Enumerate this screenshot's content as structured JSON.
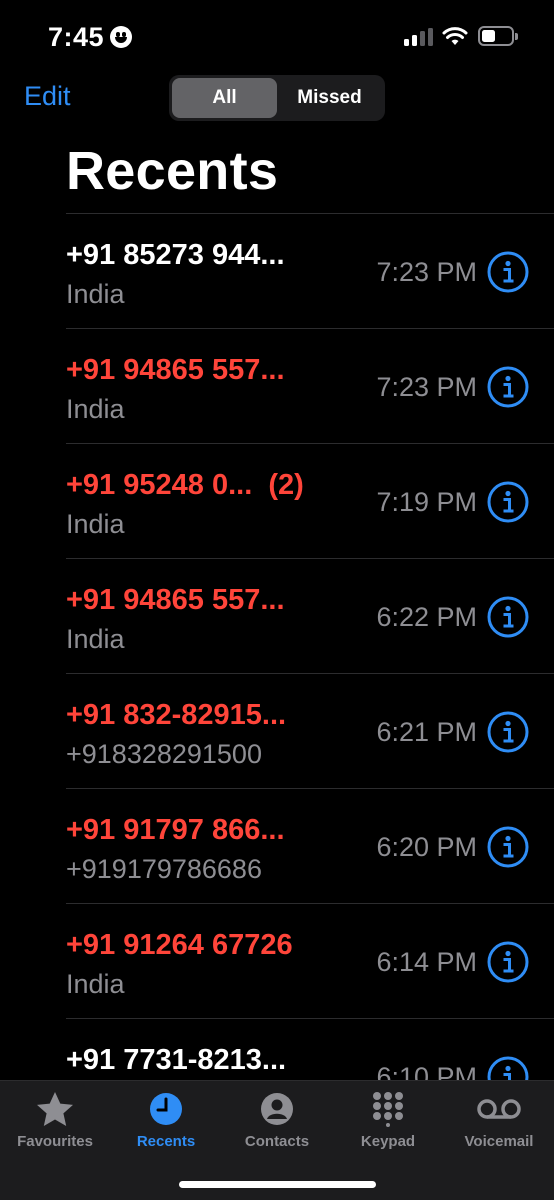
{
  "status_bar": {
    "time": "7:45",
    "emoji_icon": "smiley-face-icon",
    "signal_icon": "cellular-signal-icon",
    "wifi_icon": "wifi-icon",
    "battery_icon": "battery-icon",
    "battery_level": 0.45
  },
  "header": {
    "edit_label": "Edit",
    "segments": [
      {
        "label": "All",
        "selected": true
      },
      {
        "label": "Missed",
        "selected": false
      }
    ],
    "title": "Recents"
  },
  "calls": [
    {
      "name": "+91 85273 944...",
      "subtitle": "India",
      "time": "7:23 PM",
      "missed": false
    },
    {
      "name": "+91 94865 557...",
      "subtitle": "India",
      "time": "7:23 PM",
      "missed": true
    },
    {
      "name": "+91 95248 0...  (2)",
      "subtitle": "India",
      "time": "7:19 PM",
      "missed": true
    },
    {
      "name": "+91 94865 557...",
      "subtitle": "India",
      "time": "6:22 PM",
      "missed": true
    },
    {
      "name": "+91 832-82915...",
      "subtitle": "+918328291500",
      "time": "6:21 PM",
      "missed": true
    },
    {
      "name": "+91 91797 866...",
      "subtitle": "+919179786686",
      "time": "6:20 PM",
      "missed": true
    },
    {
      "name": "+91 91264 67726",
      "subtitle": "India",
      "time": "6:14 PM",
      "missed": true
    },
    {
      "name": "+91 7731-8213...",
      "subtitle": "",
      "time": "6:10 PM",
      "missed": false
    }
  ],
  "tab_bar": {
    "tabs": [
      {
        "label": "Favourites",
        "icon": "star-icon",
        "active": false
      },
      {
        "label": "Recents",
        "icon": "clock-icon",
        "active": true
      },
      {
        "label": "Contacts",
        "icon": "person-icon",
        "active": false
      },
      {
        "label": "Keypad",
        "icon": "keypad-icon",
        "active": false
      },
      {
        "label": "Voicemail",
        "icon": "voicemail-icon",
        "active": false
      }
    ]
  },
  "colors": {
    "accent": "#2f8df5",
    "missed": "#ff453a",
    "secondary_text": "#8e8e93",
    "background": "#000000",
    "tab_bar": "#1c1c1e"
  }
}
